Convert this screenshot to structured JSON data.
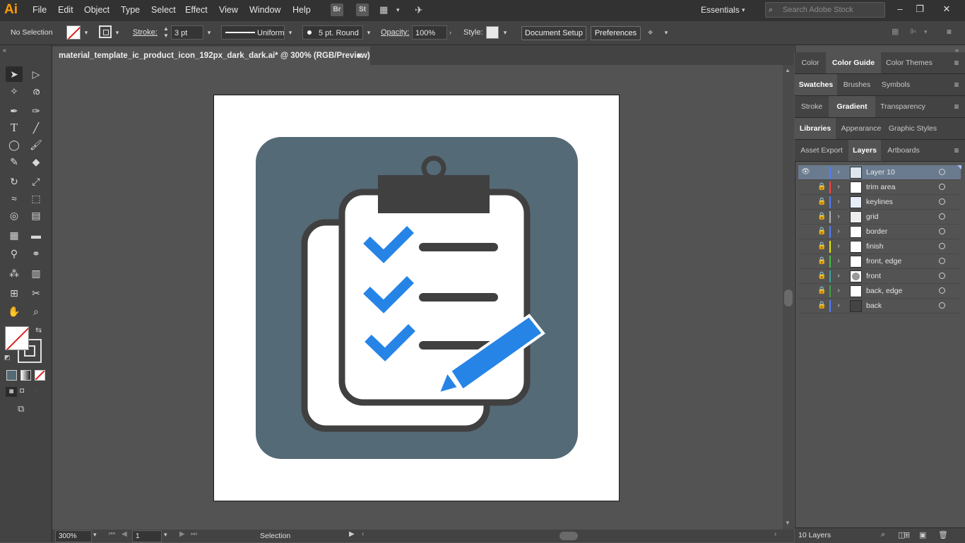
{
  "app": {
    "logo": "Ai",
    "menu": [
      "File",
      "Edit",
      "Object",
      "Type",
      "Select",
      "Effect",
      "View",
      "Window",
      "Help"
    ],
    "bridge_icon": "Br",
    "stock_icon": "St",
    "workspace": "Essentials",
    "search_placeholder": "Search Adobe Stock"
  },
  "control_bar": {
    "selection_state": "No Selection",
    "stroke_label": "Stroke:",
    "stroke_weight": "3 pt",
    "profile": "Uniform",
    "brush": "5 pt. Round",
    "opacity_label": "Opacity:",
    "opacity_value": "100%",
    "style_label": "Style:",
    "document_setup": "Document Setup",
    "preferences": "Preferences"
  },
  "document": {
    "tab_title": "material_template_ic_product_icon_192px_dark_dark.ai* @ 300% (RGB/Preview)",
    "close": "×"
  },
  "status": {
    "zoom": "300%",
    "artboard_number": "1",
    "tool": "Selection"
  },
  "panels": {
    "row1": [
      "Color",
      "Color Guide",
      "Color Themes"
    ],
    "row2": [
      "Swatches",
      "Brushes",
      "Symbols"
    ],
    "row3": [
      "Stroke",
      "Gradient",
      "Transparency"
    ],
    "row4": [
      "Libraries",
      "Appearance",
      "Graphic Styles"
    ],
    "row5": [
      "Asset Export",
      "Layers",
      "Artboards"
    ]
  },
  "layers": [
    {
      "name": "Layer 10",
      "color": "#4f7cff",
      "locked": false
    },
    {
      "name": "trim area",
      "color": "#ff4040",
      "locked": true
    },
    {
      "name": "keylines",
      "color": "#4f7cff",
      "locked": true
    },
    {
      "name": "grid",
      "color": "#b0b0b0",
      "locked": true
    },
    {
      "name": "border",
      "color": "#4f7cff",
      "locked": true
    },
    {
      "name": "finish",
      "color": "#e6e600",
      "locked": true
    },
    {
      "name": "front, edge",
      "color": "#40c040",
      "locked": true
    },
    {
      "name": "front",
      "color": "#40a0a0",
      "locked": true
    },
    {
      "name": "back, edge",
      "color": "#40a040",
      "locked": true
    },
    {
      "name": "back",
      "color": "#4f7cff",
      "locked": true
    }
  ],
  "layers_count": "10 Layers",
  "colors": {
    "icon_background": "#546a76",
    "clipboard_outline": "#404040",
    "check_blue": "#2684e6",
    "selection_row": "#6a7b8f"
  }
}
